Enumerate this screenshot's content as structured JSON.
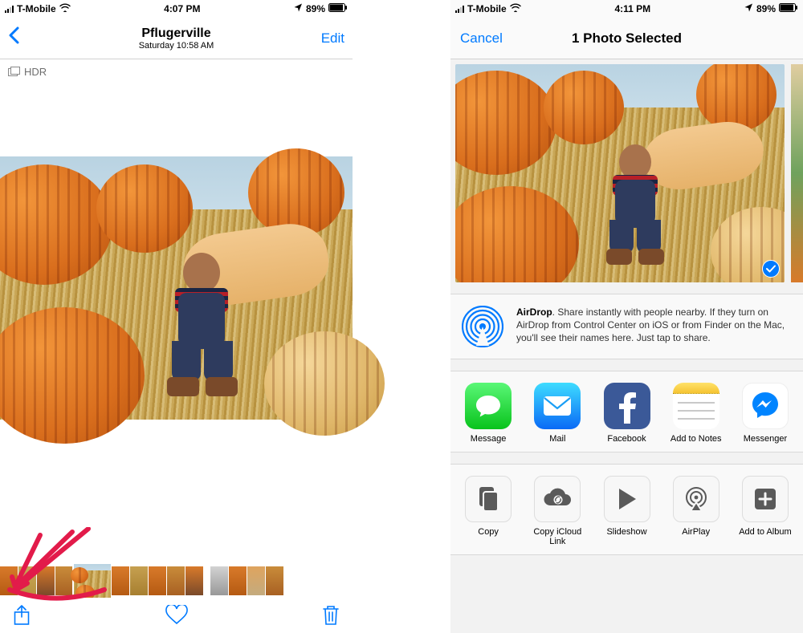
{
  "left": {
    "status": {
      "carrier": "T-Mobile",
      "time": "4:07 PM",
      "battery": "89%"
    },
    "nav": {
      "title": "Pflugerville",
      "subtitle": "Saturday  10:58 AM",
      "edit": "Edit"
    },
    "hdr_label": "HDR"
  },
  "right": {
    "status": {
      "carrier": "T-Mobile",
      "time": "4:11 PM",
      "battery": "89%"
    },
    "nav": {
      "cancel": "Cancel",
      "title": "1 Photo Selected"
    },
    "airdrop": {
      "title": "AirDrop",
      "body": ". Share instantly with people nearby. If they turn on AirDrop from Control Center on iOS or from Finder on the Mac, you'll see their names here. Just tap to share."
    },
    "apps": [
      {
        "label": "Message"
      },
      {
        "label": "Mail"
      },
      {
        "label": "Facebook"
      },
      {
        "label": "Add to Notes"
      },
      {
        "label": "Messenger"
      }
    ],
    "actions": [
      {
        "label": "Copy"
      },
      {
        "label": "Copy iCloud Link"
      },
      {
        "label": "Slideshow"
      },
      {
        "label": "AirPlay"
      },
      {
        "label": "Add to Album"
      }
    ]
  }
}
